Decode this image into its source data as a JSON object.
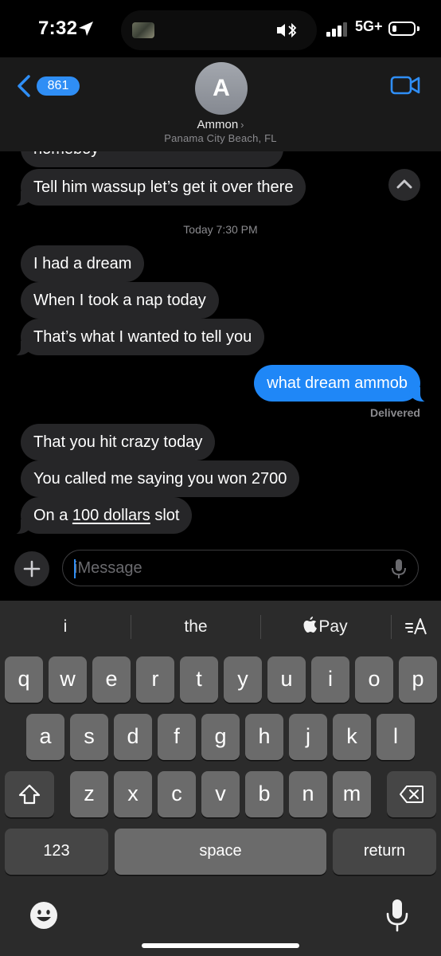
{
  "status_bar": {
    "time": "7:32",
    "network": "5G+",
    "icons": [
      "location-arrow-icon",
      "bluetooth-icon",
      "signal-icon",
      "battery-icon"
    ]
  },
  "header": {
    "back_count": "861",
    "avatar_initial": "A",
    "contact_name": "Ammon",
    "contact_location": "Panama City Beach, FL"
  },
  "messages": {
    "cut_off_prev": "homeboy",
    "m1": "Tell him wassup let’s get it over there",
    "timestamp": "Today 7:30 PM",
    "m2": "I had a dream",
    "m3": "When I took a nap today",
    "m4": "That’s what I wanted to tell you",
    "m5_sent": "what dream ammob",
    "delivered": "Delivered",
    "m6": "That you hit crazy today",
    "m7": "You called me saying you won 2700",
    "m8_before": "On a ",
    "m8_link": "100 dollars",
    "m8_after": " slot"
  },
  "compose": {
    "placeholder": "iMessage"
  },
  "keyboard": {
    "suggestions": [
      "i",
      "the",
      "Pay"
    ],
    "row1": [
      "q",
      "w",
      "e",
      "r",
      "t",
      "y",
      "u",
      "i",
      "o",
      "p"
    ],
    "row2": [
      "a",
      "s",
      "d",
      "f",
      "g",
      "h",
      "j",
      "k",
      "l"
    ],
    "row3": [
      "z",
      "x",
      "c",
      "v",
      "b",
      "n",
      "m"
    ],
    "numbers_label": "123",
    "space_label": "space",
    "return_label": "return"
  },
  "colors": {
    "accent": "#1f87f7",
    "incoming": "#262628",
    "header_bg": "#1a1a1a",
    "keyboard_bg": "#2b2b2b"
  }
}
